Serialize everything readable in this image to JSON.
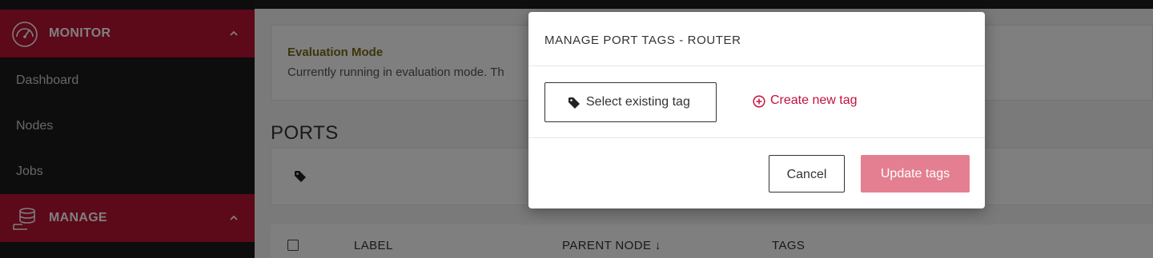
{
  "sidebar": {
    "sections": [
      {
        "label": "MONITOR",
        "icon": "gauge-icon"
      },
      {
        "label": "MANAGE",
        "icon": "database-icon"
      }
    ],
    "links": [
      "Dashboard",
      "Nodes",
      "Jobs"
    ]
  },
  "main": {
    "eval_title": "Evaluation Mode",
    "eval_text": "Currently running in evaluation mode. Th",
    "ports_title": "PORTS",
    "table": {
      "headers": [
        "LABEL",
        "PARENT NODE ↓",
        "TAGS"
      ]
    }
  },
  "modal": {
    "title": "MANAGE PORT TAGS - ROUTER",
    "select_existing_label": "Select existing tag",
    "create_new_label": "Create new tag",
    "cancel_label": "Cancel",
    "update_label": "Update tags"
  },
  "colors": {
    "brand_red": "#b81233",
    "link_red": "#c3123e",
    "update_button_disabled": "#e37f91"
  }
}
